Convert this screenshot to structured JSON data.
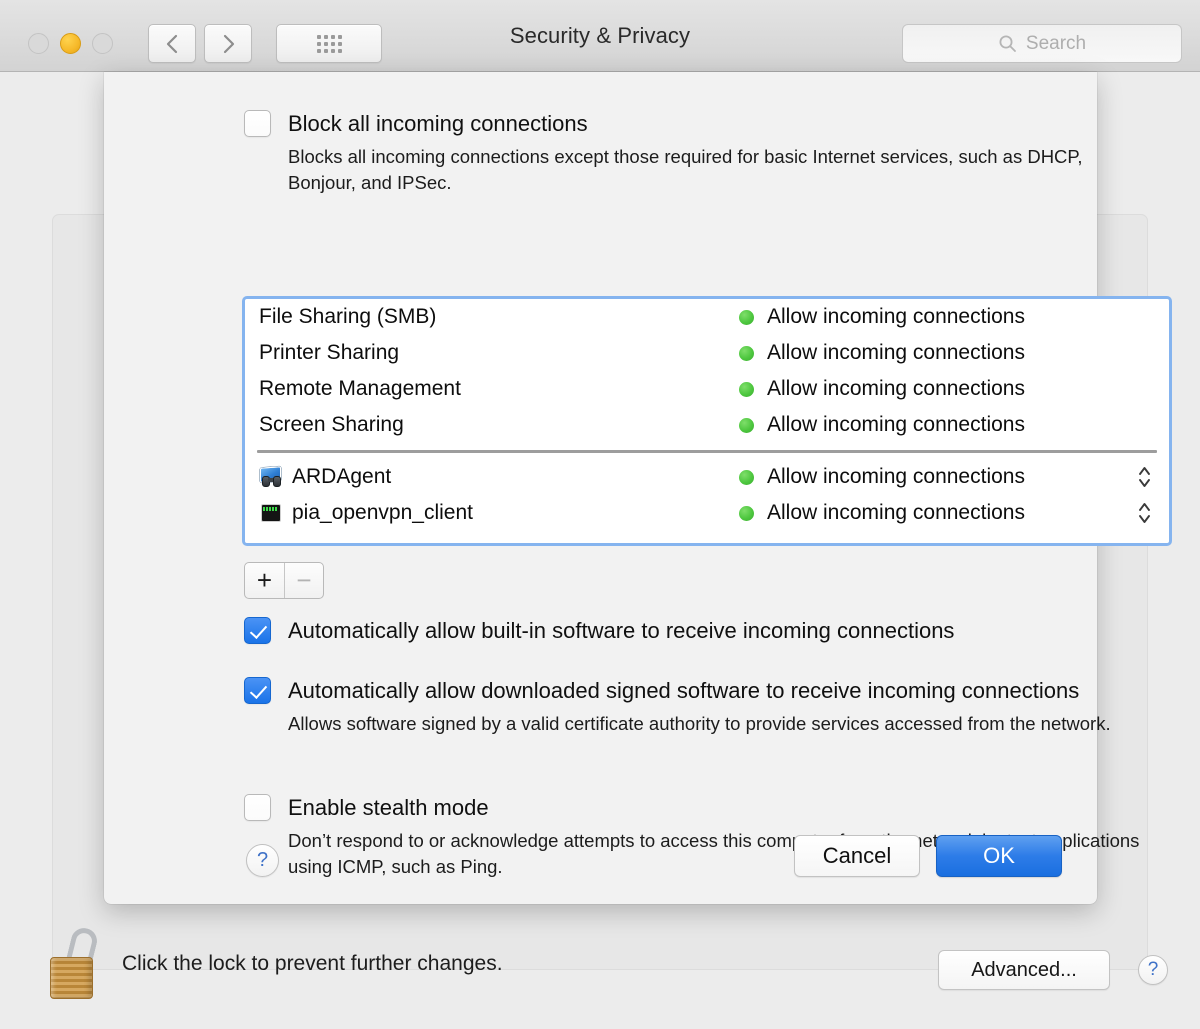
{
  "window": {
    "title": "Security & Privacy",
    "traffic_lights": [
      "close-inactive",
      "minimize",
      "zoom-inactive"
    ],
    "toolbar": {
      "back_icon": "chevron-left-icon",
      "forward_icon": "chevron-right-icon",
      "grid_icon": "show-all-grid-icon",
      "search_placeholder": "Search",
      "search_icon": "search-icon"
    }
  },
  "sheet": {
    "block_all": {
      "label": "Block all incoming connections",
      "checked": false,
      "description": "Blocks all incoming connections except those required for basic Internet services, such as DHCP, Bonjour, and IPSec."
    },
    "services": [
      {
        "name": "File Sharing (SMB)",
        "status": "Allow incoming connections",
        "status_color": "#4ec73f",
        "icon": null,
        "stepper": false
      },
      {
        "name": "Printer Sharing",
        "status": "Allow incoming connections",
        "status_color": "#4ec73f",
        "icon": null,
        "stepper": false
      },
      {
        "name": "Remote Management",
        "status": "Allow incoming connections",
        "status_color": "#4ec73f",
        "icon": null,
        "stepper": false
      },
      {
        "name": "Screen Sharing",
        "status": "Allow incoming connections",
        "status_color": "#4ec73f",
        "icon": null,
        "stepper": false
      }
    ],
    "apps": [
      {
        "name": "ARDAgent",
        "status": "Allow incoming connections",
        "status_color": "#4ec73f",
        "icon": "remote-desktop-icon",
        "stepper": true
      },
      {
        "name": "pia_openvpn_client",
        "status": "Allow incoming connections",
        "status_color": "#4ec73f",
        "icon": "terminal-icon",
        "stepper": true
      }
    ],
    "add_button": "+",
    "remove_button": "−",
    "auto_builtin": {
      "label": "Automatically allow built-in software to receive incoming connections",
      "checked": true
    },
    "auto_signed": {
      "label": "Automatically allow downloaded signed software to receive incoming connections",
      "checked": true,
      "description": "Allows software signed by a valid certificate authority to provide services accessed from the network."
    },
    "stealth": {
      "label": "Enable stealth mode",
      "checked": false,
      "description": "Don’t respond to or acknowledge attempts to access this computer from the network by test applications using ICMP, such as Ping."
    },
    "help_button": "?",
    "cancel_button": "Cancel",
    "ok_button": "OK"
  },
  "footer": {
    "lock_icon": "unlocked-padlock-icon",
    "lock_text": "Click the lock to prevent further changes.",
    "advanced_button": "Advanced...",
    "help_button": "?"
  }
}
